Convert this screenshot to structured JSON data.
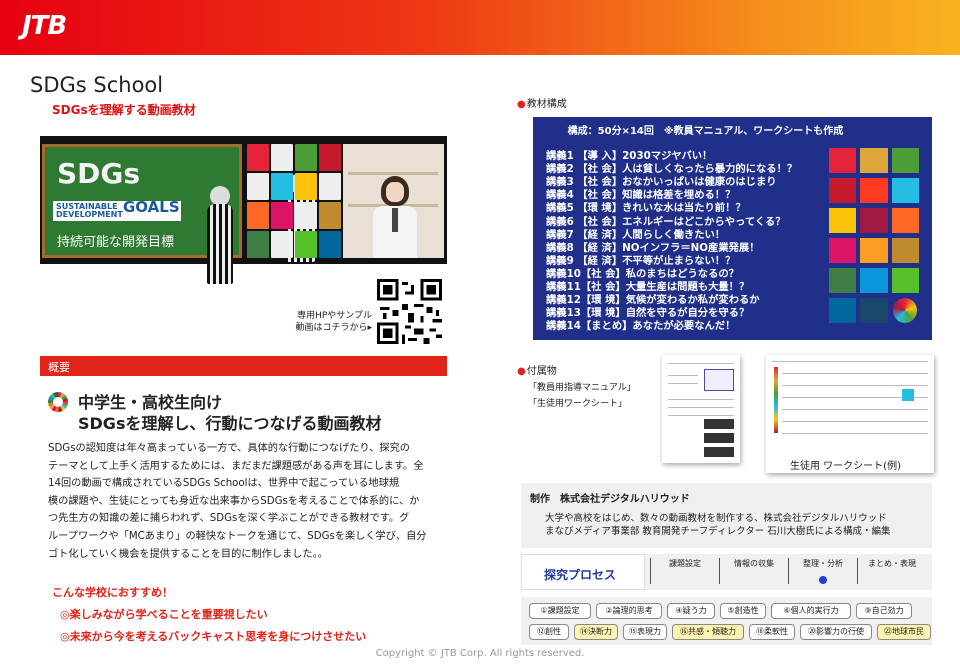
{
  "header": {
    "logo": "JTB"
  },
  "title": "SDGs School",
  "subtitle": "SDGsを理解する動画教材",
  "video": {
    "board_title": "SDGs",
    "board_badge_small": "SUSTAINABLE DEVELOPMENT",
    "board_badge_goals": "GOALS",
    "board_caption": "持続可能な開発目標"
  },
  "qr_caption": [
    "専用HPやサンプル",
    "動画はコチラから▸"
  ],
  "overview": {
    "section_label": "概要",
    "heading_lines": [
      "中学生・高校生向け",
      "SDGsを理解し、行動につなげる動画教材"
    ],
    "body_lines": [
      "SDGsの認知度は年々高まっている一方で、具体的な行動につなげたり、探究の",
      "テーマとして上手く活用するためには、まだまだ課題感がある声を耳にします。全",
      "14回の動画で構成されているSDGs Schoolは、世界中で起こっている地球規",
      "模の課題や、生徒にとっても身近な出来事からSDGsを考えることで体系的に、か",
      "つ先生方の知識の差に捕らわれず、SDGsを深く学ぶことができる教材です。グ",
      "ループワークや「MCあまり」の軽快なトークを通じて、SDGsを楽しく学び、自分",
      "ゴト化していく機会を提供することを目的に制作しました。。"
    ]
  },
  "recommend": {
    "heading": "こんな学校におすすめ！",
    "items": [
      "◎楽しみながら学べることを重要視したい",
      "◎未来から今を考えるバックキャスト思考を身につけさせたい"
    ]
  },
  "curriculum": {
    "label": "教材構成",
    "title": "構成：50分×14回　※教員マニュアル、ワークシートも作成",
    "lessons": [
      "講義1 【導 入】2030マジヤバい！",
      "講義2 【社 会】人は貧しくなったら暴力的になる！？",
      "講義3 【社 会】おなかいっぱいは健康のはじまり",
      "講義4 【社 会】知識は格差を埋める！？",
      "講義5 【環 境】きれいな水は当たり前！？",
      "講義6 【社 会】エネルギーはどこからやってくる？",
      "講義7 【経 済】人間らしく働きたい！",
      "講義8 【経 済】NOインフラ＝NO産業発展！",
      "講義9 【経 済】不平等が止まらない！？",
      "講義10【社 会】私のまちはどうなるの？",
      "講義11【社 会】大量生産は問題も大量！？",
      "講義12【環 境】気候が変わるか私が変わるか",
      "講義13【環 境】自然を守るが自分を守る？",
      "講義14【まとめ】あなたが必要なんだ！"
    ],
    "sdg_colors": [
      "#e5243b",
      "#dda63a",
      "#4c9f38",
      "#c5192d",
      "#ff3a21",
      "#26bde2",
      "#fcc30b",
      "#a21942",
      "#fd6925",
      "#dd1367",
      "#fd9d24",
      "#bf8b2e",
      "#3f7e44",
      "#0a97d9",
      "#56c02b",
      "#00689d",
      "#19486a",
      "#ffffff"
    ]
  },
  "attachments": {
    "label": "付属物",
    "items": [
      "「教員用指導マニュアル」",
      "「生徒用ワークシート」"
    ],
    "worksheet_caption": "生徒用 ワークシート(例)"
  },
  "producer": {
    "title": "制作　株式会社デジタルハリウッド",
    "lines": [
      "大学や高校をはじめ、数々の動画教材を制作する、株式会社デジタルハリウッド",
      "まなびメディア事業部 教育開発チーフディレクター 石川大樹氏による構成・編集"
    ]
  },
  "process": {
    "label": "探究プロセス",
    "stages": [
      "課題設定",
      "情報の収集",
      "整理・分析",
      "まとめ・表現"
    ],
    "active_stage": 2
  },
  "skills": {
    "row1": [
      "①課題設定",
      "②論理的思考",
      "④疑う力",
      "⑤創造性",
      "⑥個人的実行力",
      "⑨自己効力"
    ],
    "row2": [
      "⑫創性",
      "⑭決断力",
      "⑮表現力",
      "⑯共感・傾聴力",
      "⑱柔軟性",
      "⑳影響力の行使",
      "㉒地球市民"
    ],
    "highlighted_row2": [
      1,
      3,
      6
    ]
  },
  "footer": {
    "copyright": "Copyright © JTB Corp. All rights reserved."
  }
}
